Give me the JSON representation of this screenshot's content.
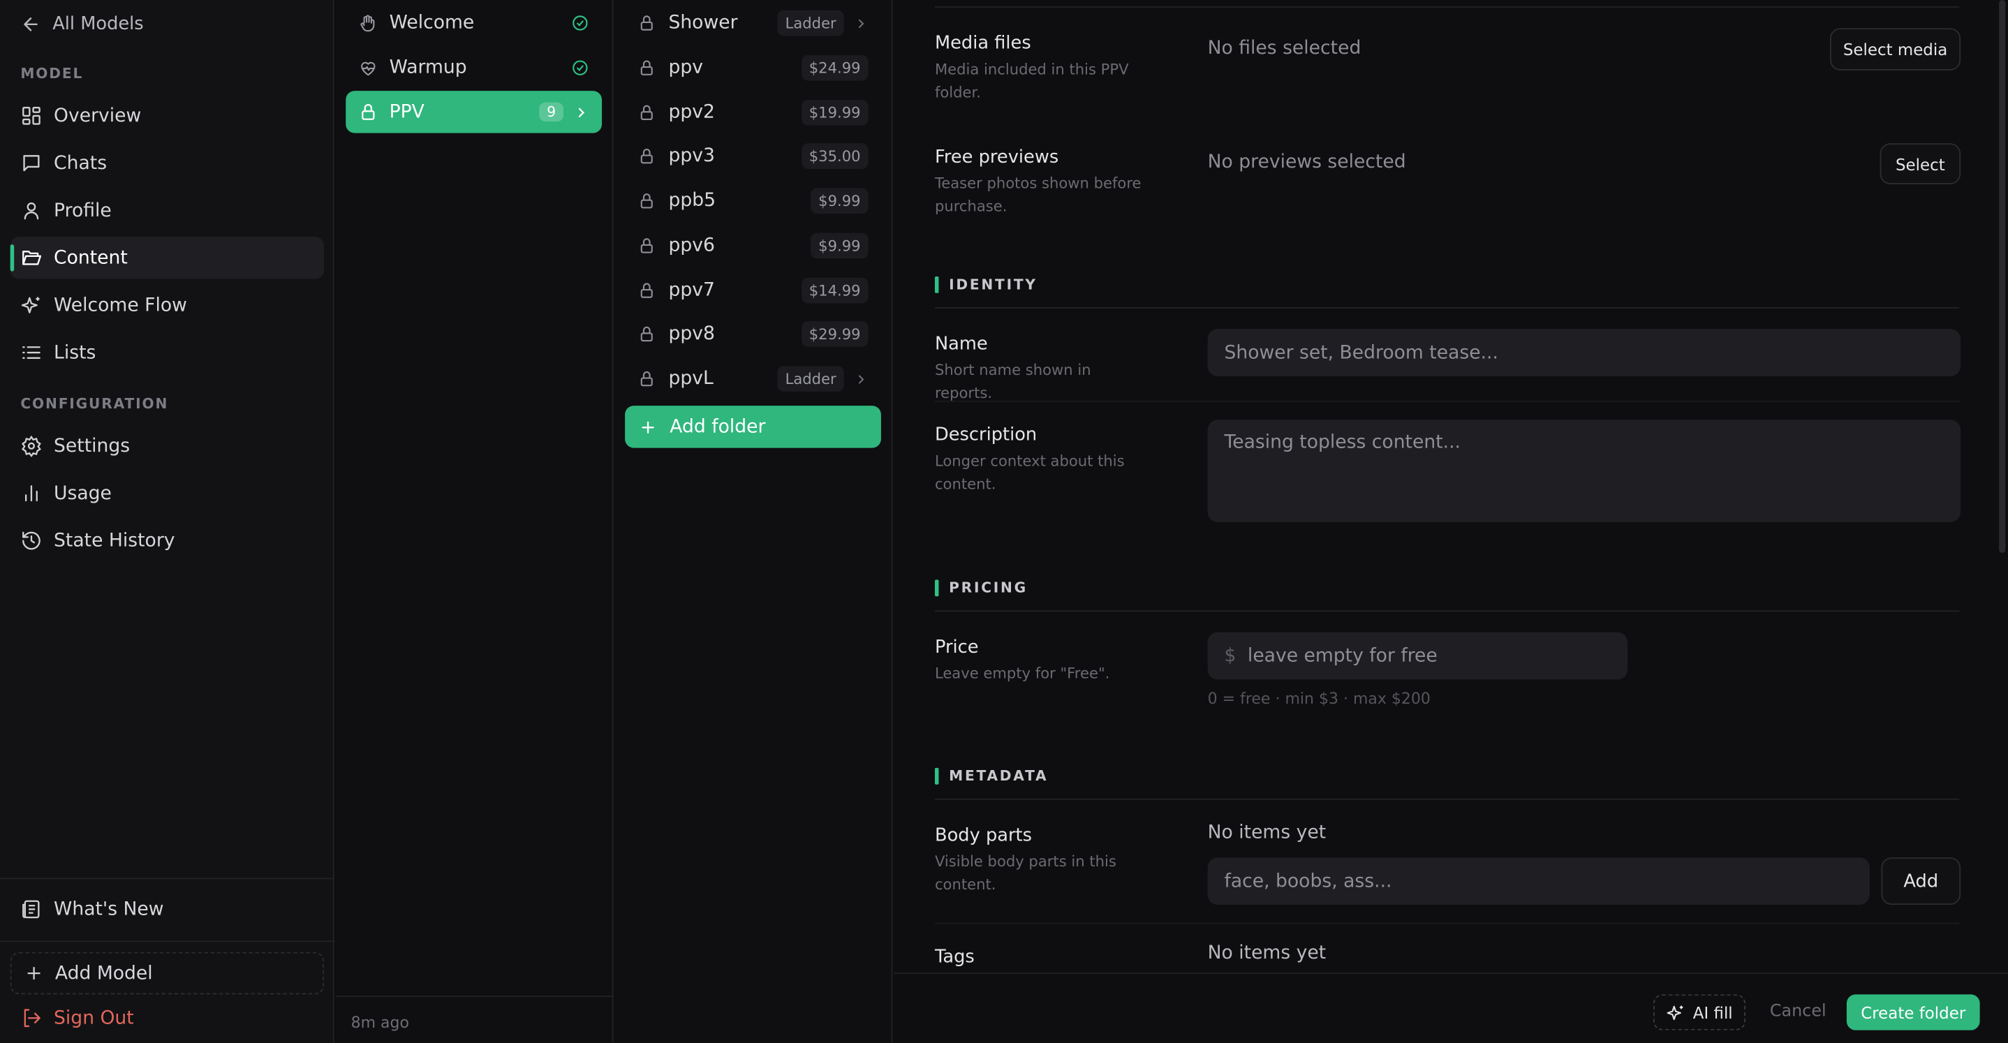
{
  "sidebar": {
    "back_label": "All Models",
    "section_model": "MODEL",
    "items_model": [
      {
        "label": "Overview",
        "icon": "dashboard-icon"
      },
      {
        "label": "Chats",
        "icon": "chat-icon"
      },
      {
        "label": "Profile",
        "icon": "user-icon"
      },
      {
        "label": "Content",
        "icon": "folder-open-icon",
        "active": true
      },
      {
        "label": "Welcome Flow",
        "icon": "sparkles-icon"
      },
      {
        "label": "Lists",
        "icon": "list-icon"
      }
    ],
    "section_config": "CONFIGURATION",
    "items_config": [
      {
        "label": "Settings",
        "icon": "gear-icon"
      },
      {
        "label": "Usage",
        "icon": "bar-chart-icon"
      },
      {
        "label": "State History",
        "icon": "history-icon"
      }
    ],
    "whats_new": "What's New",
    "add_model": "Add Model",
    "sign_out": "Sign Out"
  },
  "flows": {
    "items": [
      {
        "label": "Welcome",
        "icon": "hand-icon",
        "status": "check"
      },
      {
        "label": "Warmup",
        "icon": "heart-pulse-icon",
        "status": "check"
      },
      {
        "label": "PPV",
        "icon": "lock-icon",
        "count": "9",
        "active": true
      }
    ],
    "updated": "8m ago"
  },
  "folders": {
    "items": [
      {
        "label": "Shower",
        "tag": "Ladder",
        "chevron": true
      },
      {
        "label": "ppv",
        "tag": "$24.99"
      },
      {
        "label": "ppv2",
        "tag": "$19.99"
      },
      {
        "label": "ppv3",
        "tag": "$35.00"
      },
      {
        "label": "ppb5",
        "tag": "$9.99"
      },
      {
        "label": "ppv6",
        "tag": "$9.99"
      },
      {
        "label": "ppv7",
        "tag": "$14.99"
      },
      {
        "label": "ppv8",
        "tag": "$29.99"
      },
      {
        "label": "ppvL",
        "tag": "Ladder",
        "chevron": true
      }
    ],
    "add_label": "Add folder"
  },
  "form": {
    "media": {
      "label": "Media files",
      "help": "Media included in this PPV folder.",
      "value": "No files selected",
      "button": "Select media"
    },
    "previews": {
      "label": "Free previews",
      "help": "Teaser photos shown before purchase.",
      "value": "No previews selected",
      "button": "Select"
    },
    "identity_title": "IDENTITY",
    "name": {
      "label": "Name",
      "help": "Short name shown in reports.",
      "placeholder": "Shower set, Bedroom tease..."
    },
    "description": {
      "label": "Description",
      "help": "Longer context about this content.",
      "placeholder": "Teasing topless content..."
    },
    "pricing_title": "PRICING",
    "price": {
      "label": "Price",
      "help": "Leave empty for \"Free\".",
      "currency": "$",
      "placeholder": "leave empty for free",
      "hint": "0 = free · min $3 · max $200"
    },
    "metadata_title": "METADATA",
    "body_parts": {
      "label": "Body parts",
      "help": "Visible body parts in this content.",
      "empty": "No items yet",
      "placeholder": "face, boobs, ass...",
      "button": "Add"
    },
    "tags": {
      "label": "Tags",
      "empty": "No items yet"
    }
  },
  "footer": {
    "ai_fill": "AI fill",
    "cancel": "Cancel",
    "create": "Create folder"
  },
  "colors": {
    "accent": "#2fb77d",
    "danger": "#e2675c",
    "background": "#0e0e10"
  }
}
